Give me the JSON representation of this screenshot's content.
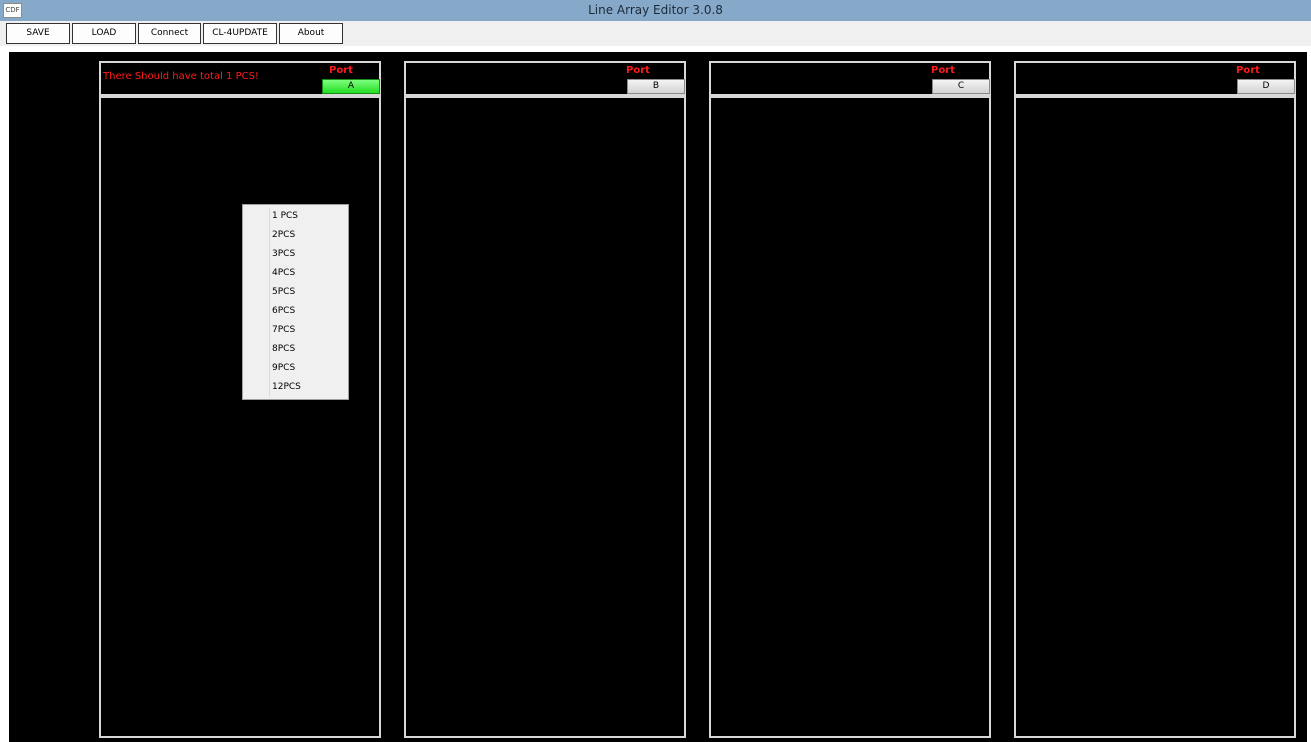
{
  "window": {
    "title": "Line Array Editor 3.0.8",
    "app_icon_text": "CDF"
  },
  "toolbar": {
    "buttons": [
      {
        "label": "SAVE"
      },
      {
        "label": "LOAD"
      },
      {
        "label": "Connect"
      },
      {
        "label": "CL-4UPDATE"
      },
      {
        "label": "About"
      }
    ]
  },
  "panels": [
    {
      "port_label": "Port",
      "port_button": "A",
      "active": true,
      "warning": "There Should have total 1 PCS!"
    },
    {
      "port_label": "Port",
      "port_button": "B",
      "active": false
    },
    {
      "port_label": "Port",
      "port_button": "C",
      "active": false
    },
    {
      "port_label": "Port",
      "port_button": "D",
      "active": false
    }
  ],
  "context_menu": {
    "items": [
      "1 PCS",
      "2PCS",
      "3PCS",
      "4PCS",
      "5PCS",
      "6PCS",
      "7PCS",
      "8PCS",
      "9PCS",
      "12PCS"
    ]
  },
  "colors": {
    "titlebar": "#86a9c9",
    "workspace": "#000000",
    "warning_text": "#ff1a1a",
    "active_port": "#22dd22"
  }
}
